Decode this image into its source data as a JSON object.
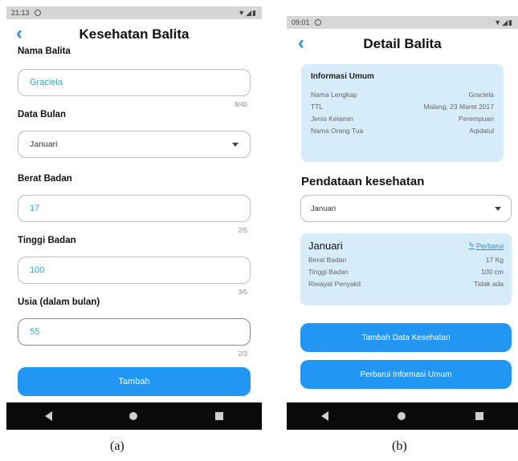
{
  "phone_a": {
    "status": {
      "time": "21:13",
      "icons": "▼◢▮"
    },
    "title": "Kesehatan Balita",
    "nama_balita": {
      "label": "Nama Balita",
      "value": "Graciela",
      "counter": "8/40"
    },
    "data_bulan": {
      "label": "Data Bulan",
      "value": "Januari"
    },
    "berat_badan": {
      "label": "Berat Badan",
      "value": "17",
      "counter": "2/5"
    },
    "tinggi_badan": {
      "label": "Tinggi Badan",
      "value": "100",
      "counter": "3/5"
    },
    "usia": {
      "label": "Usia (dalam bulan)",
      "value": "55",
      "counter": "2/3"
    },
    "submit_label": "Tambah"
  },
  "phone_b": {
    "status": {
      "time": "09:01",
      "icons": "▼◢▮"
    },
    "title": "Detail Balita",
    "info": {
      "heading": "Informasi Umum",
      "rows": [
        {
          "label": "Nama Lengkap",
          "value": "Graciela"
        },
        {
          "label": "TTL",
          "value": "Malang, 23 Maret 2017"
        },
        {
          "label": "Jenis Kelamin",
          "value": "Perempuan"
        },
        {
          "label": "Nama Orang Tua",
          "value": "Aqidatul"
        }
      ]
    },
    "section_title": "Pendataan kesehatan",
    "month_select": "Januari",
    "record": {
      "month": "Januari",
      "update_label": "Perbarui",
      "rows": [
        {
          "label": "Berat Badan",
          "value": "17 Kg"
        },
        {
          "label": "Tinggi Badan",
          "value": "100 cm"
        },
        {
          "label": "Riwayat Penyakit",
          "value": "Tidak ada"
        }
      ]
    },
    "add_button": "Tambah Data Kesehatan",
    "update_button": "Perbarui Informasi Umum"
  },
  "captions": {
    "a": "(a)",
    "b": "(b)"
  },
  "colors": {
    "primary": "#2196f3",
    "card": "#d6ecf8",
    "value_text": "#3aa9b5"
  }
}
